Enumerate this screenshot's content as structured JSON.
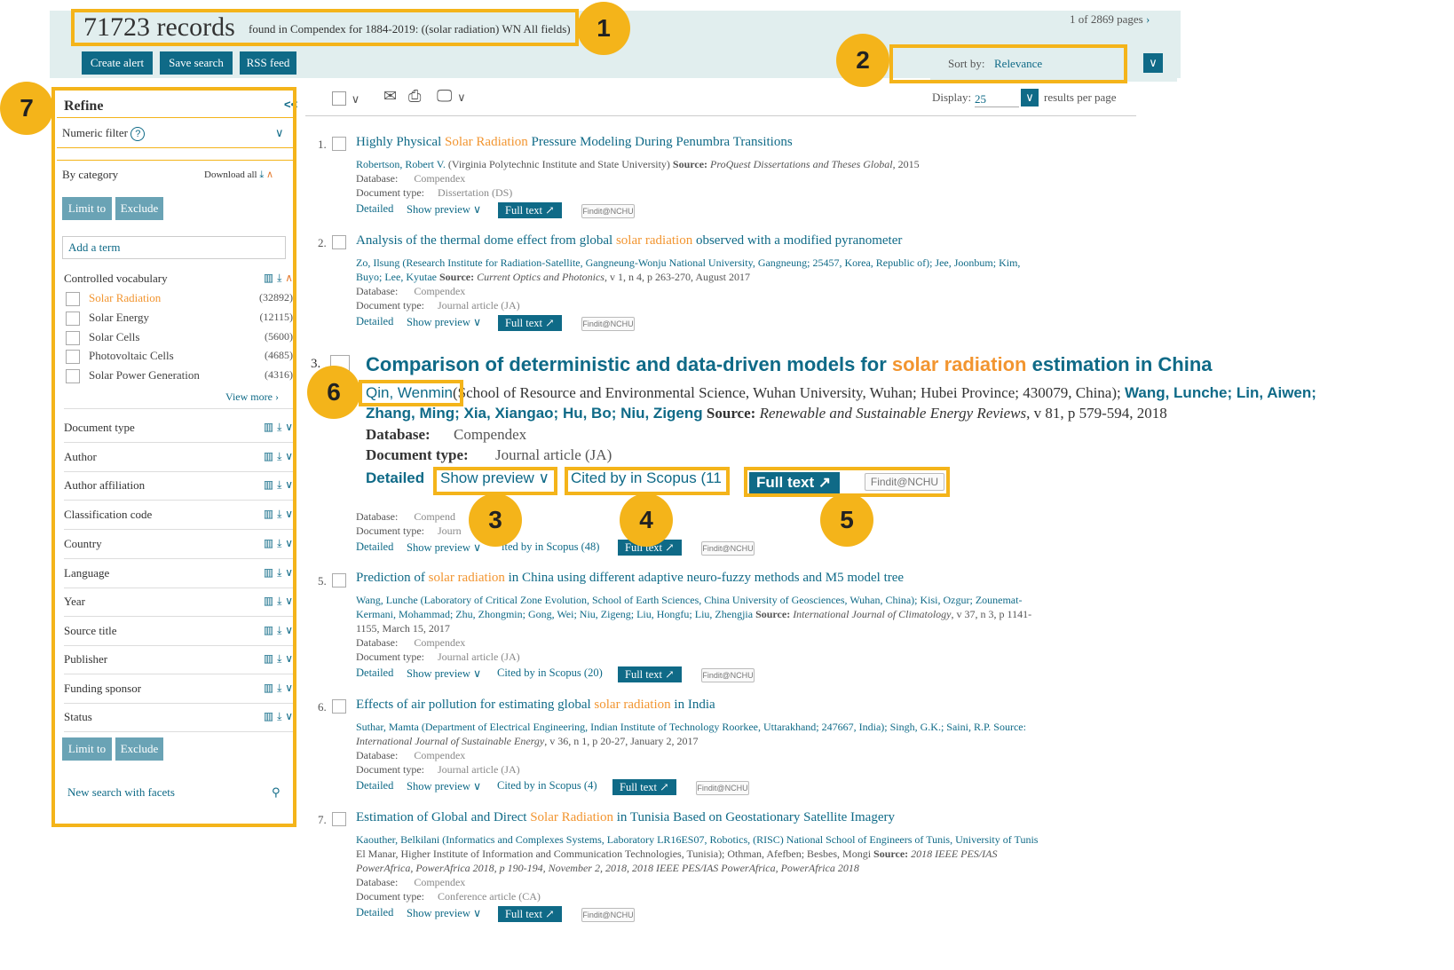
{
  "header": {
    "record_count": "71723 records",
    "found_text": "found in Compendex for 1884-2019: ((solar radiation) WN All fields)",
    "pages": "1 of 2869 pages",
    "buttons": [
      "Create alert",
      "Save search",
      "RSS feed"
    ]
  },
  "sort": {
    "label": "Sort by:",
    "value": "Relevance"
  },
  "display": {
    "label": "Display:",
    "value": "25",
    "suffix": "results per page"
  },
  "refine": {
    "title": "Refine",
    "collapse": "<<",
    "numeric_filter": "Numeric filter",
    "by_category": "By category",
    "download_all": "Download all",
    "limit_to": "Limit to",
    "exclude": "Exclude",
    "add_term_placeholder": "Add a term",
    "controlled_vocabulary": "Controlled vocabulary",
    "vocab_items": [
      {
        "name": "Solar Radiation",
        "count": "(32892)"
      },
      {
        "name": "Solar Energy",
        "count": "(12115)"
      },
      {
        "name": "Solar Cells",
        "count": "(5600)"
      },
      {
        "name": "Photovoltaic Cells",
        "count": "(4685)"
      },
      {
        "name": "Solar Power Generation",
        "count": "(4316)"
      }
    ],
    "view_more": "View more",
    "facets": [
      "Document type",
      "Author",
      "Author affiliation",
      "Classification code",
      "Country",
      "Language",
      "Year",
      "Source title",
      "Publisher",
      "Funding sponsor",
      "Status"
    ],
    "new_search": "New search with facets"
  },
  "labels": {
    "database": "Database:",
    "doctype": "Document type:",
    "detailed": "Detailed",
    "show_preview": "Show preview",
    "full_text": "Full text",
    "findit": "Findit@NCHU",
    "source": "Source:"
  },
  "results": [
    {
      "num": "1.",
      "t1": "Highly Physical ",
      "hl": "Solar Radiation",
      "t2": " Pressure Modeling During Penumbra Transitions",
      "authors": "Robertson, Robert V.",
      "affil": " (Virginia Polytechnic Institute and State University) ",
      "src": "ProQuest Dissertations and Theses Global",
      "tail": ", 2015",
      "db": "Compendex",
      "dt": "Dissertation (DS)",
      "cited": ""
    },
    {
      "num": "2.",
      "t1": "Analysis of the thermal dome effect from global ",
      "hl": "solar radiation",
      "t2": " observed with a modified pyranometer",
      "line1": "Zo, Ilsung (Research Institute for Radiation-Satellite, Gangneung-Wonju National University, Gangneung; 25457, Korea, Republic of); Jee, Joonbum; Kim,",
      "line2a": "Buyo; Lee, Kyutae ",
      "src": "Current Optics and Photonics",
      "tail": ", v 1, n 4, p 263-270, August 2017",
      "db": "Compendex",
      "dt": "Journal article (JA)",
      "cited": ""
    },
    {
      "num": "5.",
      "t1": "Prediction of ",
      "hl": "solar radiation",
      "t2": " in China using different adaptive neuro-fuzzy methods and M5 model tree",
      "line1": "Wang, Lunche (Laboratory of Critical Zone Evolution, School of Earth Sciences, China University of Geosciences, Wuhan, China); Kisi, Ozgur; Zounemat-",
      "line2a": "Kermani, Mohammad; Zhu, Zhongmin; Gong, Wei; Niu, Zigeng; Liu, Hongfu; Liu, Zhengjia ",
      "src": "International Journal of Climatology",
      "tail": ", v 37, n 3, p 1141-",
      "line3": "1155, March 15, 2017",
      "db": "Compendex",
      "dt": "Journal article (JA)",
      "cited": "Cited by in Scopus (20)"
    },
    {
      "num": "6.",
      "t1": "Effects of air pollution for estimating global ",
      "hl": "solar radiation",
      "t2": " in India",
      "line1": "Suthar, Mamta (Department of Electrical Engineering, Indian Institute of Technology Roorkee, Uttarakhand; 247667, India); Singh, G.K.; Saini, R.P. Source:",
      "line2a": "",
      "src": "International Journal of Sustainable Energy",
      "tail": ", v 36, n 1, p 20-27, January 2, 2017",
      "db": "Compendex",
      "dt": "Journal article (JA)",
      "cited": "Cited by in Scopus (4)"
    },
    {
      "num": "7.",
      "t1": "Estimation of Global and Direct ",
      "hl": "Solar Radiation",
      "t2": " in Tunisia Based on Geostationary Satellite Imagery",
      "line1": "Kaouther, Belkilani (Informatics and Complexes Systems, Laboratory LR16ES07, Robotics, (RISC) National School of Engineers of Tunis, University of Tunis",
      "line2a": "El Manar, Higher Institute of Information and Communication Technologies, Tunisia); Othman, Afefben; Besbes, Mongi ",
      "src": "2018 IEEE PES/IAS",
      "line3": "PowerAfrica, PowerAfrica 2018, p 190-194, November 2, 2018, 2018 IEEE PES/IAS PowerAfrica, PowerAfrica 2018",
      "db": "Compendex",
      "dt": "Conference article (CA)",
      "cited": ""
    }
  ],
  "result4_partial": {
    "db": "Database:",
    "db_val": "Compend",
    "dt": "Document type:",
    "dt_val": "Journ",
    "cited": "ited by in Scopus (48)",
    "ft": "Full text"
  },
  "zoom": {
    "num": "3.",
    "t1": "Comparison of deterministic and data-driven models for ",
    "hl": "solar radiation",
    "t2": " estimation in China",
    "author_first": "Qin, Wenmin",
    "affil": "(School of Resource and Environmental Science, Wuhan University, Wuhan; Hubei Province; 430079, China); ",
    "authors_more1": "Wang, Lunche; Lin, Aiwen;",
    "authors_more2": "Zhang, Ming; Xia, Xiangao; Hu, Bo; Niu, Zigeng",
    "source_label": "Source:",
    "source": "Renewable and Sustainable Energy Reviews",
    "source_tail": ", v 81, p 579-594, 2018",
    "db_label": "Database:",
    "db": "Compendex",
    "dt_label": "Document type:",
    "dt": "Journal article (JA)",
    "detailed": "Detailed",
    "show_preview": "Show preview",
    "cited": "Cited by in Scopus (11",
    "full_text": "Full text",
    "findit": "Findit@NCHU"
  },
  "badges": [
    "1",
    "2",
    "3",
    "4",
    "5",
    "6",
    "7"
  ],
  "colors": {
    "accent": "#0f6a87",
    "highlight": "#f4b41a",
    "term": "#f29530"
  }
}
